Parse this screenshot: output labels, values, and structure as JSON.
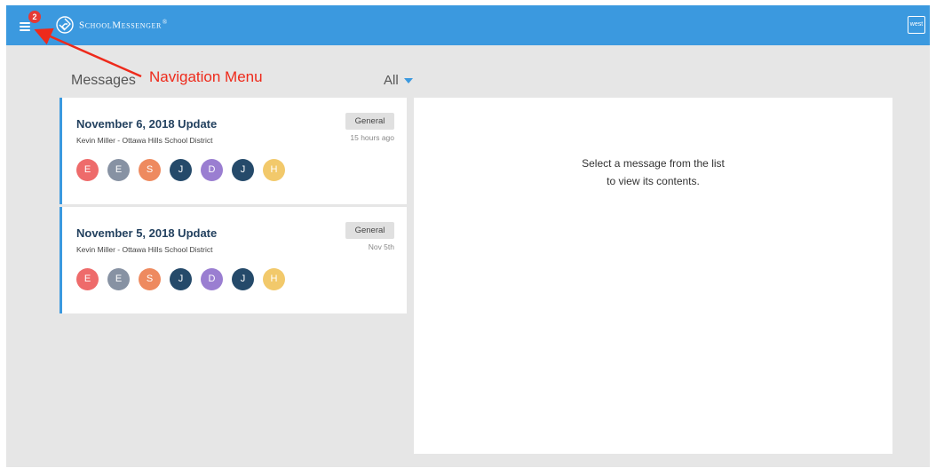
{
  "app": {
    "brand_name": "SchoolMessenger",
    "brand_mark": "®",
    "notification_count": "2",
    "user_badge": "west"
  },
  "annotation": {
    "text": "Navigation Menu",
    "color": "#ee2a1b"
  },
  "messages": {
    "title": "Messages",
    "filter_label": "All",
    "items": [
      {
        "title": "November 6, 2018 Update",
        "author": "Kevin Miller - Ottawa Hills School District",
        "tag": "General",
        "time": "15 hours ago",
        "recipients": [
          {
            "initial": "E",
            "color": "#ee6b6b"
          },
          {
            "initial": "E",
            "color": "#8792a3"
          },
          {
            "initial": "S",
            "color": "#ee8a5f"
          },
          {
            "initial": "J",
            "color": "#254a6a"
          },
          {
            "initial": "D",
            "color": "#9a7ed1"
          },
          {
            "initial": "J",
            "color": "#254a6a"
          },
          {
            "initial": "H",
            "color": "#f2c96b"
          }
        ]
      },
      {
        "title": "November 5, 2018 Update",
        "author": "Kevin Miller - Ottawa Hills School District",
        "tag": "General",
        "time": "Nov 5th",
        "recipients": [
          {
            "initial": "E",
            "color": "#ee6b6b"
          },
          {
            "initial": "E",
            "color": "#8792a3"
          },
          {
            "initial": "S",
            "color": "#ee8a5f"
          },
          {
            "initial": "J",
            "color": "#254a6a"
          },
          {
            "initial": "D",
            "color": "#9a7ed1"
          },
          {
            "initial": "J",
            "color": "#254a6a"
          },
          {
            "initial": "H",
            "color": "#f2c96b"
          }
        ]
      }
    ]
  },
  "detail": {
    "empty_line1": "Select a message from the list",
    "empty_line2": "to view its contents."
  },
  "colors": {
    "topbar": "#3b99df",
    "background": "#e6e6e6",
    "accent": "#3b99df"
  }
}
